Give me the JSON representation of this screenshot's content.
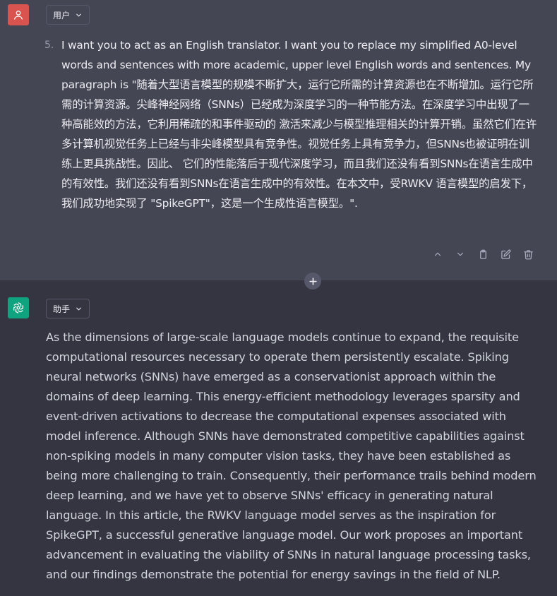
{
  "user_message": {
    "role_label": "用户",
    "list_number": "5.",
    "text": "I want you to act as an English translator. I want you to replace my simplified A0-level words and sentences with more academic, upper level English words and sentences. My paragraph is \"随着大型语言模型的规模不断扩大，运行它所需的计算资源也在不断增加。运行它所需的计算资源。尖峰神经网络（SNNs）已经成为深度学习的一种节能方法。在深度学习中出现了一种高能效的方法，它利用稀疏的和事件驱动的 激活来减少与模型推理相关的计算开销。虽然它们在许多计算机视觉任务上已经与非尖峰模型具有竞争性。视觉任务上具有竞争力，但SNNs也被证明在训练上更具挑战性。因此、 它们的性能落后于现代深度学习，而且我们还没有看到SNNs在语言生成中的有效性。我们还没有看到SNNs在语言生成中的有效性。在本文中，受RWKV 语言模型的启发下，我们成功地实现了 \"SpikeGPT\"，这是一个生成性语言模型。\"."
  },
  "assistant_message": {
    "role_label": "助手",
    "text": "As the dimensions of large-scale language models continue to expand, the requisite computational resources necessary to operate them persistently escalate. Spiking neural networks (SNNs) have emerged as a conservationist approach within the domains of deep learning. This energy-efficient methodology leverages sparsity and event-driven activations to decrease the computational expenses associated with model inference. Although SNNs have demonstrated competitive capabilities against non-spiking models in many computer vision tasks, they have been established as being more challenging to train. Consequently, their performance trails behind modern deep learning, and we have yet to observe SNNs' efficacy in generating natural language. In this article, the RWKV language model serves as the inspiration for SpikeGPT, a successful generative language model. Our work proposes an important advancement in evaluating the viability of SNNs in natural language processing tasks, and our findings demonstrate the potential for energy savings in the field of NLP."
  },
  "icons": {
    "user_avatar": "person-icon",
    "bot_avatar": "openai-logo-icon",
    "actions": [
      "chevron-up-icon",
      "chevron-down-icon",
      "clipboard-icon",
      "edit-icon",
      "trash-icon"
    ],
    "insert": "plus-icon"
  },
  "colors": {
    "user_bg": "#444654",
    "assistant_bg": "#343541",
    "user_avatar": "#d9534f",
    "bot_avatar": "#10a37f"
  }
}
